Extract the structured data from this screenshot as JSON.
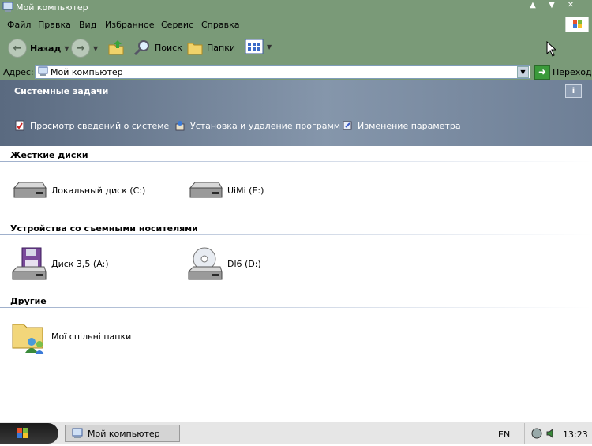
{
  "window": {
    "title": "Мой компьютер"
  },
  "menu": [
    "Файл",
    "Правка",
    "Вид",
    "Избранное",
    "Сервис",
    "Справка"
  ],
  "toolbar": {
    "back": "Назад",
    "search": "Поиск",
    "folders": "Папки"
  },
  "address": {
    "label": "Адрес:",
    "value": "Мой компьютер",
    "go": "Переход"
  },
  "tasks": {
    "header": "Системные задачи",
    "items": [
      "Просмотр сведений о системе",
      "Установка и удаление программ",
      "Изменение параметра"
    ]
  },
  "sections": {
    "hard_disks": {
      "title": "Жесткие диски",
      "items": [
        "Локальный диск (C:)",
        "UiMi (E:)"
      ]
    },
    "removable": {
      "title": "Устройства со съемными носителями",
      "items": [
        "Диск 3,5 (A:)",
        "Dl6 (D:)"
      ]
    },
    "other": {
      "title": "Другие",
      "items": [
        "Мої спільні папки"
      ]
    }
  },
  "taskbar": {
    "window_button": "Мой компьютер",
    "lang": "EN",
    "clock": "13:23"
  },
  "colors": {
    "chrome": "#7a9a78",
    "tasks_panel": "#6e7f96"
  }
}
